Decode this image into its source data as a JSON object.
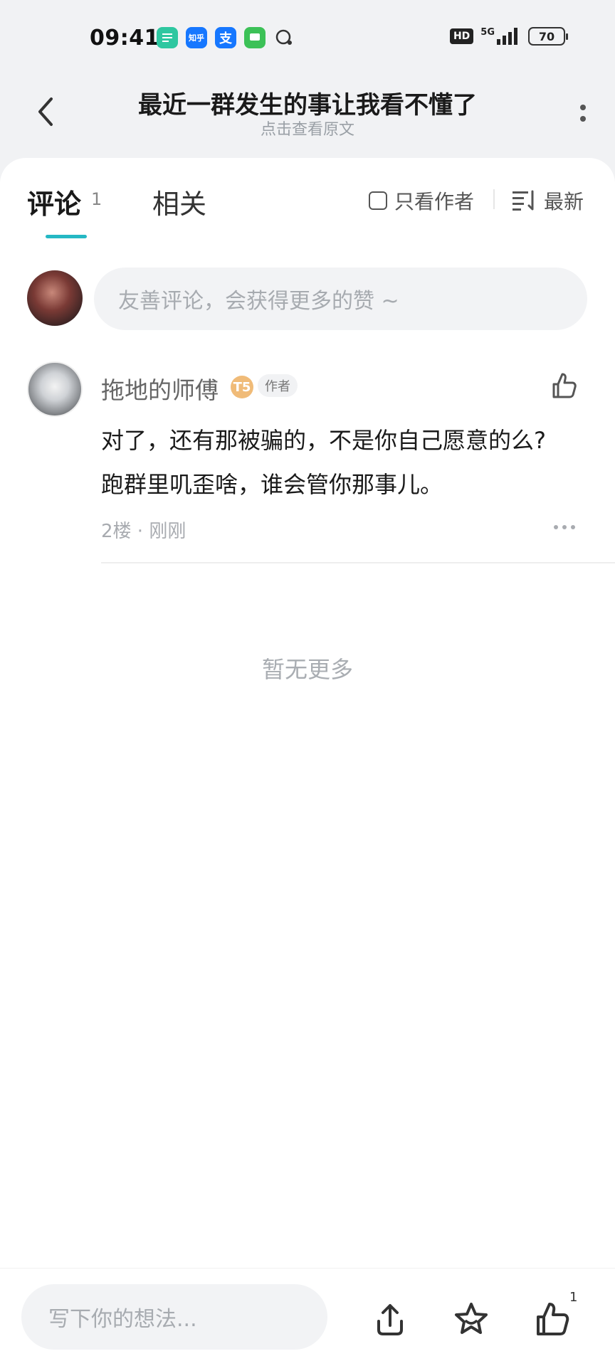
{
  "status_bar": {
    "time": "09:41",
    "notifications": [
      {
        "name": "doc-app-icon",
        "color": "#2ec7a0",
        "label": ""
      },
      {
        "name": "zhihu-app-icon",
        "color": "#1677ff",
        "label": "知乎"
      },
      {
        "name": "alipay-app-icon",
        "color": "#1677ff",
        "label": "支"
      },
      {
        "name": "messages-app-icon",
        "color": "#3cc157",
        "label": ""
      }
    ],
    "hd": "HD",
    "network": "5G",
    "battery": "70"
  },
  "header": {
    "title": "最近一群发生的事让我看不懂了",
    "subtitle": "点击查看原文"
  },
  "tabs": {
    "comments_label": "评论",
    "comments_count": "1",
    "related_label": "相关",
    "author_only_label": "只看作者",
    "sort_label": "最新"
  },
  "comment_input": {
    "placeholder": "友善评论，会获得更多的赞 ~"
  },
  "comments": [
    {
      "author": "拖地的师傅",
      "level_badge": "T5",
      "author_tag": "作者",
      "text_line1": "对了，还有那被骗的，不是你自己愿意的么?",
      "text_line2": "跑群里叽歪啥，谁会管你那事儿。",
      "meta": "2楼 · 刚刚"
    }
  ],
  "no_more_text": "暂无更多",
  "bottom_bar": {
    "write_placeholder": "写下你的想法...",
    "like_count": "1"
  },
  "colors": {
    "accent": "#25b8c4",
    "badge": "#f0bb78"
  }
}
